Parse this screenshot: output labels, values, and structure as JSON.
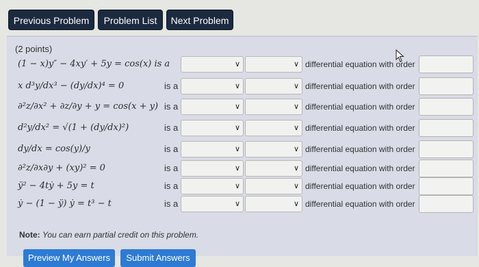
{
  "nav": {
    "previous": "Previous Problem",
    "list": "Problem List",
    "next": "Next Problem"
  },
  "problem": {
    "points": "(2 points)",
    "rows": [
      {
        "equation": "(1 − x)y″ − 4xy′ + 5y = cos(x) is a",
        "is_a": "",
        "selected_1": "",
        "selected_2": "",
        "suffix": "differential equation with order",
        "order_value": ""
      },
      {
        "equation": "x d³y/dx³ − (dy/dx)⁴ = 0",
        "is_a": "is a",
        "selected_1": "",
        "selected_2": "",
        "suffix": "differential equation with order",
        "order_value": ""
      },
      {
        "equation": "∂²z/∂x² + ∂z/∂y + y = cos(x + y)",
        "is_a": "is a",
        "selected_1": "",
        "selected_2": "",
        "suffix": "differential equation with order",
        "order_value": ""
      },
      {
        "equation": "d²y/dx² = √(1 + (dy/dx)²)",
        "is_a": "is a",
        "selected_1": "",
        "selected_2": "",
        "suffix": "differential equation with order",
        "order_value": ""
      },
      {
        "equation": "dy/dx = cos(y)/y",
        "is_a": "is a",
        "selected_1": "",
        "selected_2": "",
        "suffix": "differential equation with order",
        "order_value": ""
      },
      {
        "equation": "∂²z/∂x∂y + (xy)² = 0",
        "is_a": "is a",
        "selected_1": "",
        "selected_2": "",
        "suffix": "differential equation with order",
        "order_value": ""
      },
      {
        "equation": "ÿ² − 4tẏ + 5y = t",
        "is_a": "is a",
        "selected_1": "",
        "selected_2": "",
        "suffix": "differential equation with order",
        "order_value": ""
      },
      {
        "equation": "ẏ − (1 − ÿ) ẏ = t³ − t",
        "is_a": "is a",
        "selected_1": "",
        "selected_2": "",
        "suffix": "differential equation with order",
        "order_value": ""
      }
    ]
  },
  "note": {
    "label": "Note:",
    "text": "You can earn partial credit on this problem."
  },
  "actions": {
    "preview": "Preview My Answers",
    "submit": "Submit Answers"
  },
  "icons": {
    "dropdown": "chevron-down-icon",
    "cursor": "mouse-pointer-icon"
  },
  "colors": {
    "nav_bg": "#1b2a3f",
    "button_blue": "#2d7bd4",
    "panel_bg": "#d9dbe6"
  }
}
